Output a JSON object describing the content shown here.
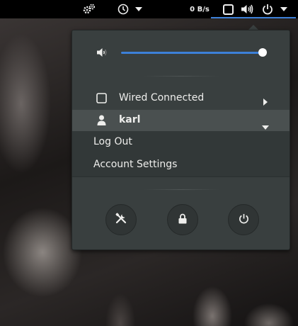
{
  "topbar": {
    "network_speed": "0 B/s",
    "icons": [
      "system-tools-icon",
      "clock-icon",
      "dropdown-arrow-icon",
      "screen-icon",
      "volume-icon",
      "power-icon",
      "dropdown-arrow-icon"
    ]
  },
  "menu": {
    "volume": {
      "level": 0.97,
      "icon": "volume-low-icon"
    },
    "network": {
      "label": "Wired Connected",
      "icon": "network-wired-icon"
    },
    "user": {
      "name": "karl",
      "icon": "user-icon",
      "items": [
        {
          "label": "Log Out"
        },
        {
          "label": "Account Settings"
        }
      ]
    },
    "actions": [
      "settings-icon",
      "lock-icon",
      "power-off-icon"
    ]
  },
  "colors": {
    "accent": "#3d80d8",
    "menu_bg": "#393f3f",
    "highlight": "#4a5050",
    "topbar": "#000000"
  }
}
